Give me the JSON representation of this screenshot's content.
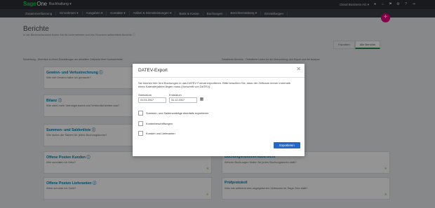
{
  "topbar": {
    "logo_sage": "Sage",
    "logo_one": "One",
    "product": "Buchhaltung ▾",
    "account": "Cloud Business AG ▾"
  },
  "nav": [
    "Zusammenfassung",
    "Einnahmen ▾",
    "Ausgaben ▾",
    "Kontakte ▾",
    "Artikel & Dienstleistungen ▾",
    "Bank & Kasse",
    "Buchungen",
    "Berichterstattung ▾",
    "Einstellungen"
  ],
  "page": {
    "title": "Berichte",
    "subtitle": "In der Berichtsübersicht finden Sie für Unternehmen und ihre Finanzen aufbereitete Berichte ⓘ",
    "fab": "+"
  },
  "tabs": [
    "Favoriten",
    "Alle Berichte"
  ],
  "sections": {
    "left": "Einstellung · Überblick zu Ihren Einstellungen als aktuellem Zeitpunkt Ihrer Kontoberichte",
    "right": "Detaillierte Berichte · Detaillierte Listen für die Überprüfung, den Export und die Analyse"
  },
  "cards_left": [
    {
      "title": "Gewinn- und Verlustrechnung ⓘ",
      "sub": "Wie viel Gewinn habe ich gemacht?"
    },
    {
      "title": "Bilanz ⓘ",
      "sub": "Wie sieht mein Vermögenswert und Verbindlichkeiten aus?"
    },
    {
      "title": "Summen- und Saldenliste ⓘ",
      "sub": "Wie lauten die Salden für jedes Buchungskonto?"
    },
    {
      "title": "Offene Posten Kunden ⓘ",
      "sub": "Wer schuldet mir Geld?"
    },
    {
      "title": "Offene Posten Lieferanten ⓘ",
      "sub": "Wem schulde ich Geld?"
    }
  ],
  "cards_right": [
    {
      "title": "Buchungsnummernübersicht",
      "sub": "Welche Buchungen finden für jedes Buchungskonto statt?"
    },
    {
      "title": "Prüfprotokoll",
      "sub": "Was hat während des angegebenen Zeitraums im Sage One statt?"
    }
  ],
  "modal": {
    "title": "DATEV-Export",
    "close": "✕",
    "description": "Sie können hier Ihre Buchungen in das DATEV Format exportieren. Bitte beachten Sie, dass der Zeitraum immer innerhalb eines Kalenderjahres liegen muss (Vorschrift von DATEV).",
    "start_label": "Startdatum",
    "start_value": "01.01.2017",
    "end_label": "Enddatum",
    "end_value": "31.12.2017",
    "checkboxes": [
      "Summen- und Saldenvorträge ebenfalls exportieren",
      "Kontenbeschriftungen",
      "Kunden und Lieferanten"
    ],
    "button": "Exportieren"
  }
}
